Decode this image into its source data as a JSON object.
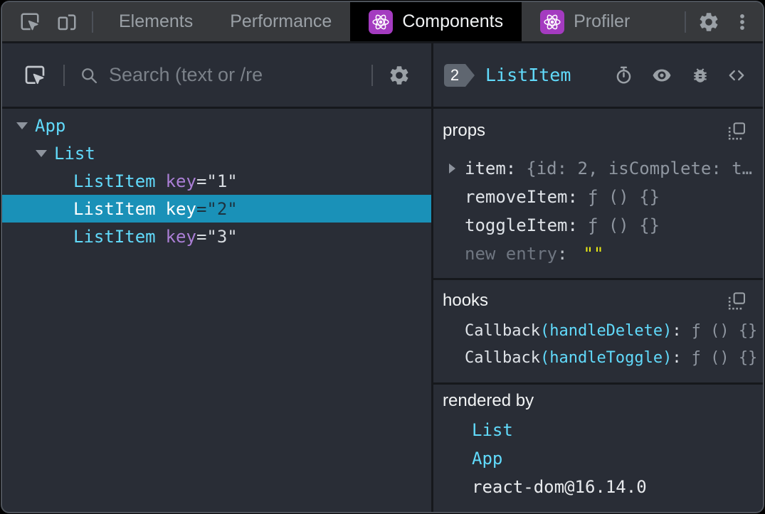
{
  "topbar": {
    "tabs": [
      {
        "label": "Elements"
      },
      {
        "label": "Performance"
      },
      {
        "label": "Components"
      },
      {
        "label": "Profiler"
      }
    ],
    "icons": {
      "inspect": "inspect-element-icon",
      "device": "device-toolbar-icon",
      "settings": "settings-gear-icon",
      "menu": "kebab-menu-icon"
    }
  },
  "left_panel": {
    "toolbar": {
      "search_placeholder": "Search (text or /re",
      "icons": {
        "inspect": "inspect-component-icon",
        "search": "search-icon",
        "settings": "settings-gear-icon"
      }
    },
    "tree": [
      {
        "label": "App",
        "depth": 0,
        "expanded": true
      },
      {
        "label": "List",
        "depth": 1,
        "expanded": true
      },
      {
        "name": "ListItem",
        "attr": "key",
        "value": "=\"1\"",
        "depth": 2,
        "selected": false
      },
      {
        "name": "ListItem",
        "attr": "key",
        "value": "=\"2\"",
        "depth": 2,
        "selected": true
      },
      {
        "name": "ListItem",
        "attr": "key",
        "value": "=\"3\"",
        "depth": 2,
        "selected": false
      }
    ]
  },
  "right_panel": {
    "header": {
      "badge": "2",
      "title": "ListItem",
      "icons": [
        "stopwatch-icon",
        "eye-icon",
        "bug-icon",
        "view-source-icon"
      ]
    },
    "punct": {
      "colon": ":"
    },
    "props": {
      "title": "props",
      "rows": [
        {
          "name": "item",
          "value": "{id: 2, isComplete: t…",
          "expandable": true
        },
        {
          "name": "removeItem",
          "value": "ƒ () {}"
        },
        {
          "name": "toggleItem",
          "value": "ƒ () {}"
        },
        {
          "name": "new entry",
          "value": "\"\"",
          "placeholder": true
        }
      ]
    },
    "hooks": {
      "title": "hooks",
      "rows": [
        {
          "name": "Callback",
          "args": "(handleDelete)",
          "value": "ƒ () {}"
        },
        {
          "name": "Callback",
          "args": "(handleToggle)",
          "value": "ƒ () {}"
        }
      ]
    },
    "rendered_by": {
      "title": "rendered by",
      "rows": [
        {
          "label": "List",
          "link": true
        },
        {
          "label": "App",
          "link": true
        },
        {
          "label": "react-dom@16.14.0",
          "link": false
        }
      ]
    }
  },
  "colors": {
    "accent_cyan": "#61dafb",
    "selected_row": "#1a91b8",
    "attr_purple": "#ab7fd6",
    "value_yellow": "#e8e815",
    "react_purple": "#a43bc0",
    "topbar_bg": "#37393c",
    "panel_bg": "#292d36"
  }
}
